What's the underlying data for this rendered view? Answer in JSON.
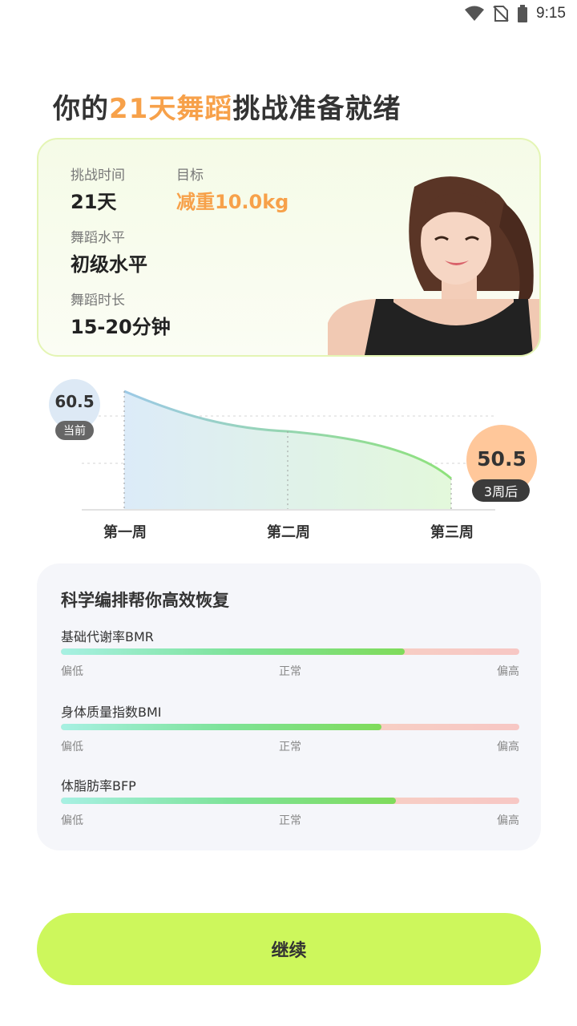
{
  "status_bar": {
    "time": "9:15"
  },
  "title": {
    "prefix": "你的",
    "highlight": "21天舞蹈",
    "suffix": "挑战准备就绪"
  },
  "summary": {
    "challenge_time_label": "挑战时间",
    "challenge_time_value": "21天",
    "goal_label": "目标",
    "goal_value": "减重10.0kg",
    "dance_level_label": "舞蹈水平",
    "dance_level_value": "初级水平",
    "dance_duration_label": "舞蹈时长",
    "dance_duration_value": "15-20分钟"
  },
  "chart_data": {
    "type": "area",
    "x": [
      "第一周",
      "第二周",
      "第三周"
    ],
    "series": [
      {
        "values": [
          60.5,
          55.9,
          50.5
        ]
      }
    ],
    "start_value": "60.5",
    "start_tag": "当前",
    "end_value": "50.5",
    "end_tag": "3周后",
    "grid": false,
    "colors": {
      "line_start": "#9cc9e6",
      "line_end": "#8ee27a",
      "fill_start": "#dcebf8",
      "fill_end": "#e3f8db"
    }
  },
  "metrics": {
    "title": "科学编排帮你高效恢复",
    "items": [
      {
        "name": "基础代谢率BMR",
        "level": 0.75,
        "low": "偏低",
        "mid": "正常",
        "high": "偏高"
      },
      {
        "name": "身体质量指数BMI",
        "level": 0.7,
        "low": "偏低",
        "mid": "正常",
        "high": "偏高"
      },
      {
        "name": "体脂肪率BFP",
        "level": 0.73,
        "low": "偏低",
        "mid": "正常",
        "high": "偏高"
      }
    ]
  },
  "continue_label": "继续",
  "colors": {
    "accent_orange": "#f7a14a",
    "button_green": "#cdf75c"
  }
}
